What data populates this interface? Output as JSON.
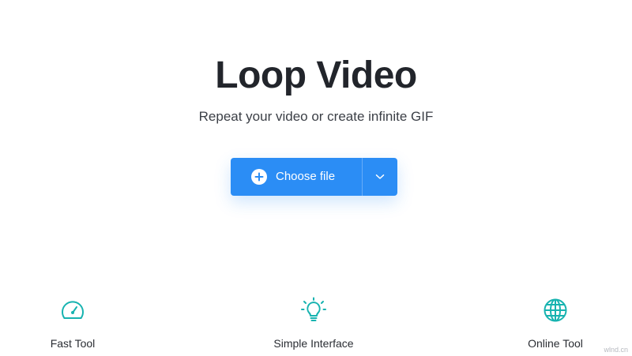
{
  "hero": {
    "title": "Loop Video",
    "subtitle": "Repeat your video or create infinite GIF"
  },
  "upload": {
    "label": "Choose file",
    "icon": "plus-circle-icon",
    "dropdown_icon": "chevron-down-icon",
    "color": "#2b8df5"
  },
  "features": [
    {
      "label": "Fast Tool",
      "icon": "speedometer-icon"
    },
    {
      "label": "Simple Interface",
      "icon": "lightbulb-icon"
    },
    {
      "label": "Online Tool",
      "icon": "globe-icon"
    }
  ],
  "accent_colors": {
    "teal": "#17b3b0",
    "blue": "#2b8df5"
  },
  "watermark": "wlnd.cn"
}
